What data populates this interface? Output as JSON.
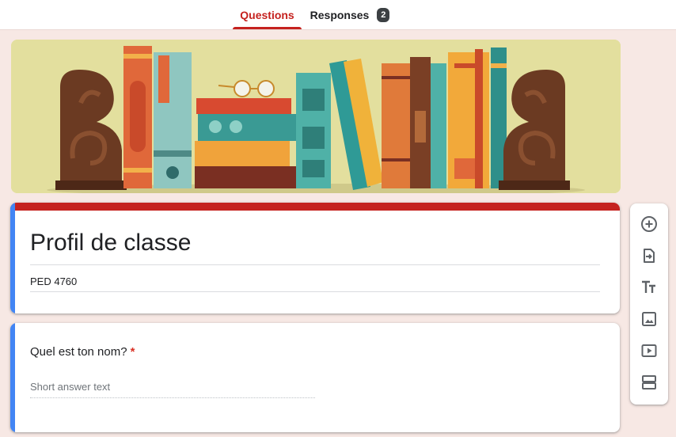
{
  "tabs": {
    "questions_label": "Questions",
    "responses_label": "Responses",
    "responses_count": "2"
  },
  "form": {
    "title": "Profil de classe",
    "description": "PED 4760"
  },
  "question": {
    "title": "Quel est ton nom?",
    "required_mark": "*",
    "answer_placeholder": "Short answer text"
  },
  "toolbar": {
    "icons": [
      "add-question-icon",
      "import-questions-icon",
      "add-title-icon",
      "add-image-icon",
      "add-video-icon",
      "add-section-icon"
    ]
  },
  "colors": {
    "accent": "#c5221f",
    "focus_bar": "#4285f4",
    "page_background": "#f7e8e4"
  }
}
